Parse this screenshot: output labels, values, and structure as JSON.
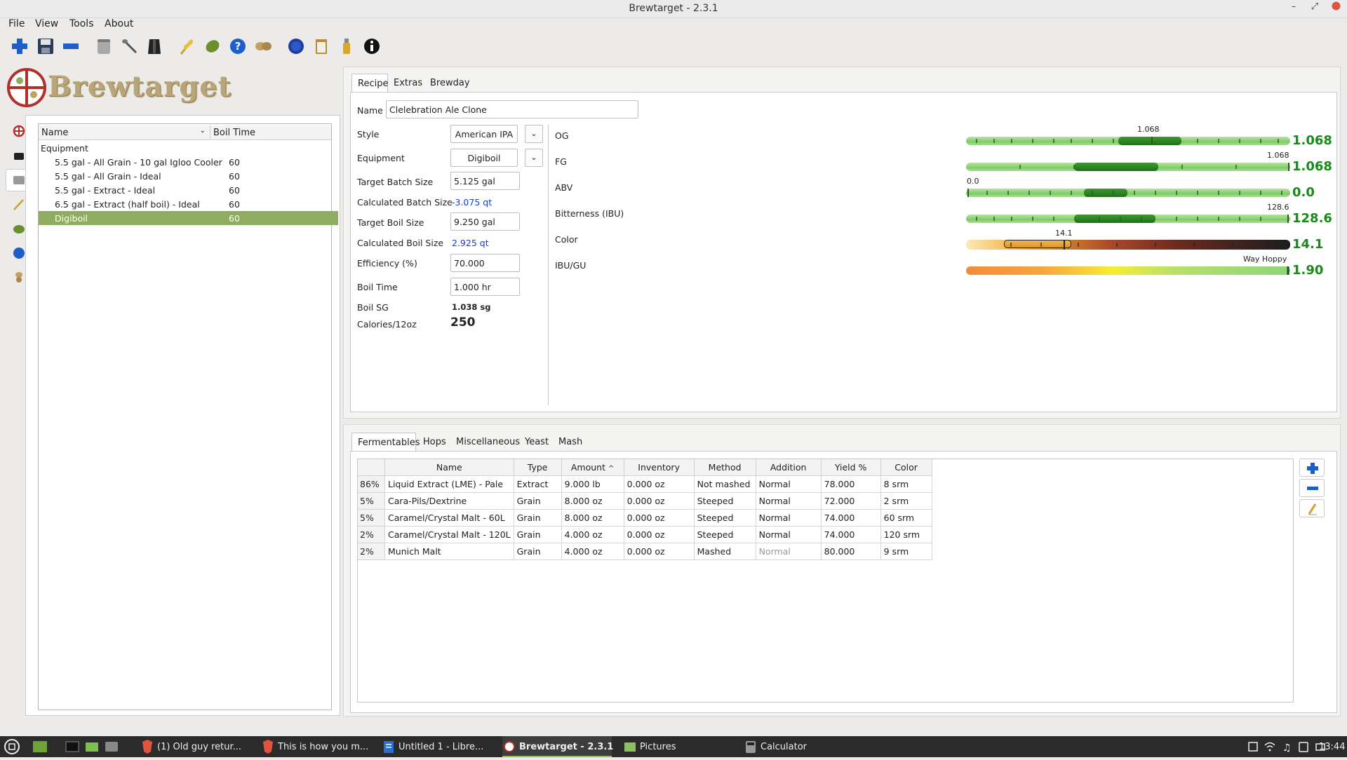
{
  "window": {
    "title": "Brewtarget - 2.3.1"
  },
  "menu": [
    "File",
    "View",
    "Tools",
    "About"
  ],
  "toolbar_icons": [
    "new-recipe-icon",
    "save-icon",
    "delete-icon",
    "can-icon",
    "spoon-icon",
    "apron-icon",
    "grain-icon",
    "hop-leaf-icon",
    "help-icon",
    "yeast-icon",
    "globe-icon",
    "clipboard-icon",
    "bottle-icon",
    "info-icon"
  ],
  "logo": {
    "text": "Brewtarget"
  },
  "tree": {
    "col_name": "Name",
    "col_boil": "Boil Time",
    "folder": "Equipment",
    "rows": [
      {
        "name": "5.5 gal - All Grain - 10 gal Igloo Cooler",
        "boil": "60"
      },
      {
        "name": "5.5 gal - All Grain - Ideal",
        "boil": "60"
      },
      {
        "name": "5.5 gal - Extract - Ideal",
        "boil": "60"
      },
      {
        "name": "6.5 gal - Extract (half boil) - Ideal",
        "boil": "60"
      },
      {
        "name": "Digiboil",
        "boil": "60"
      }
    ]
  },
  "top_tabs": [
    "Recipe",
    "Extras",
    "Brewday"
  ],
  "recipe": {
    "name_label": "Name",
    "name_value": "Clelebration Ale Clone",
    "style_label": "Style",
    "style_value": "American IPA",
    "equipment_label": "Equipment",
    "equipment_value": "Digiboil",
    "target_batch_label": "Target Batch Size",
    "target_batch_value": "5.125 gal",
    "calc_batch_label": "Calculated Batch Size",
    "calc_batch_value": "-3.075 qt",
    "target_boil_label": "Target Boil Size",
    "target_boil_value": "9.250 gal",
    "calc_boil_label": "Calculated Boil Size",
    "calc_boil_value": "2.925 qt",
    "efficiency_label": "Efficiency (%)",
    "efficiency_value": "70.000",
    "boil_time_label": "Boil Time",
    "boil_time_value": "1.000 hr",
    "boil_sg_label": "Boil SG",
    "boil_sg_value": "1.038 sg",
    "calories_label": "Calories/12oz",
    "calories_value": "250"
  },
  "meters": {
    "og": {
      "label": "OG",
      "top": "1.068",
      "value": "1.068"
    },
    "fg": {
      "label": "FG",
      "top": "1.068",
      "value": "1.068"
    },
    "abv": {
      "label": "ABV",
      "top": "0.0",
      "value": "0.0"
    },
    "ibu": {
      "label": "Bitterness (IBU)",
      "top": "128.6",
      "value": "128.6"
    },
    "color": {
      "label": "Color",
      "top": "14.1",
      "value": "14.1"
    },
    "ibugu": {
      "label": "IBU/GU",
      "top": "Way Hoppy",
      "value": "1.90"
    }
  },
  "bottom_tabs": [
    "Fermentables",
    "Hops",
    "Miscellaneous",
    "Yeast",
    "Mash"
  ],
  "fermentables": {
    "headers": [
      "Name",
      "Type",
      "Amount",
      "Inventory",
      "Method",
      "Addition",
      "Yield %",
      "Color"
    ],
    "rows": [
      {
        "pct": "86%",
        "name": "Liquid Extract (LME) - Pale",
        "type": "Extract",
        "amount": "9.000 lb",
        "inventory": "0.000 oz",
        "method": "Not mashed",
        "addition": "Normal",
        "yield": "78.000",
        "color": "8 srm"
      },
      {
        "pct": "5%",
        "name": "Cara-Pils/Dextrine",
        "type": "Grain",
        "amount": "8.000 oz",
        "inventory": "0.000 oz",
        "method": "Steeped",
        "addition": "Normal",
        "yield": "72.000",
        "color": "2 srm"
      },
      {
        "pct": "5%",
        "name": "Caramel/Crystal Malt - 60L",
        "type": "Grain",
        "amount": "8.000 oz",
        "inventory": "0.000 oz",
        "method": "Steeped",
        "addition": "Normal",
        "yield": "74.000",
        "color": "60 srm"
      },
      {
        "pct": "2%",
        "name": "Caramel/Crystal Malt - 120L",
        "type": "Grain",
        "amount": "4.000 oz",
        "inventory": "0.000 oz",
        "method": "Steeped",
        "addition": "Normal",
        "yield": "74.000",
        "color": "120 srm"
      },
      {
        "pct": "2%",
        "name": "Munich Malt",
        "type": "Grain",
        "amount": "4.000 oz",
        "inventory": "0.000 oz",
        "method": "Mashed",
        "addition": "Normal",
        "yield": "80.000",
        "color": "9 srm"
      }
    ]
  },
  "taskbar": {
    "items": [
      "(1) Old guy retur...",
      "This is how you m...",
      "Untitled 1 - Libre...",
      "Brewtarget - 2.3.1",
      "Pictures",
      "Calculator"
    ],
    "clock": "13:44"
  }
}
